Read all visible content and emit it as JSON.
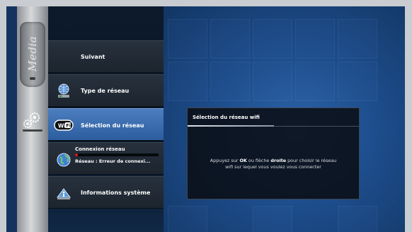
{
  "rail": {
    "logo_text": "Media"
  },
  "menu": {
    "items": [
      {
        "label": "Suivant",
        "icon": "none"
      },
      {
        "label": "Type de réseau",
        "icon": "network-globe-icon"
      },
      {
        "label": "Sélection du réseau",
        "icon": "wifi-icon",
        "selected": true
      },
      {
        "title": "Connexion réseau",
        "status": "Réseau : Erreur de connexi...",
        "icon": "globe-icon"
      },
      {
        "label": "Informations système",
        "icon": "info-icon"
      }
    ]
  },
  "dialog": {
    "title": "Sélection du réseau wifi",
    "text_part1": "Appuyez sur ",
    "text_ok": "OK",
    "text_part2": " ou flèche ",
    "text_right": "droite",
    "text_part3": " pour choisir le réseau",
    "text_line2": "wifi sur lequel vous voulez vous connecter"
  },
  "colors": {
    "selected_item": "#3a6db0",
    "background_blue": "#1d4c8a",
    "error_dot": "#e01818"
  }
}
